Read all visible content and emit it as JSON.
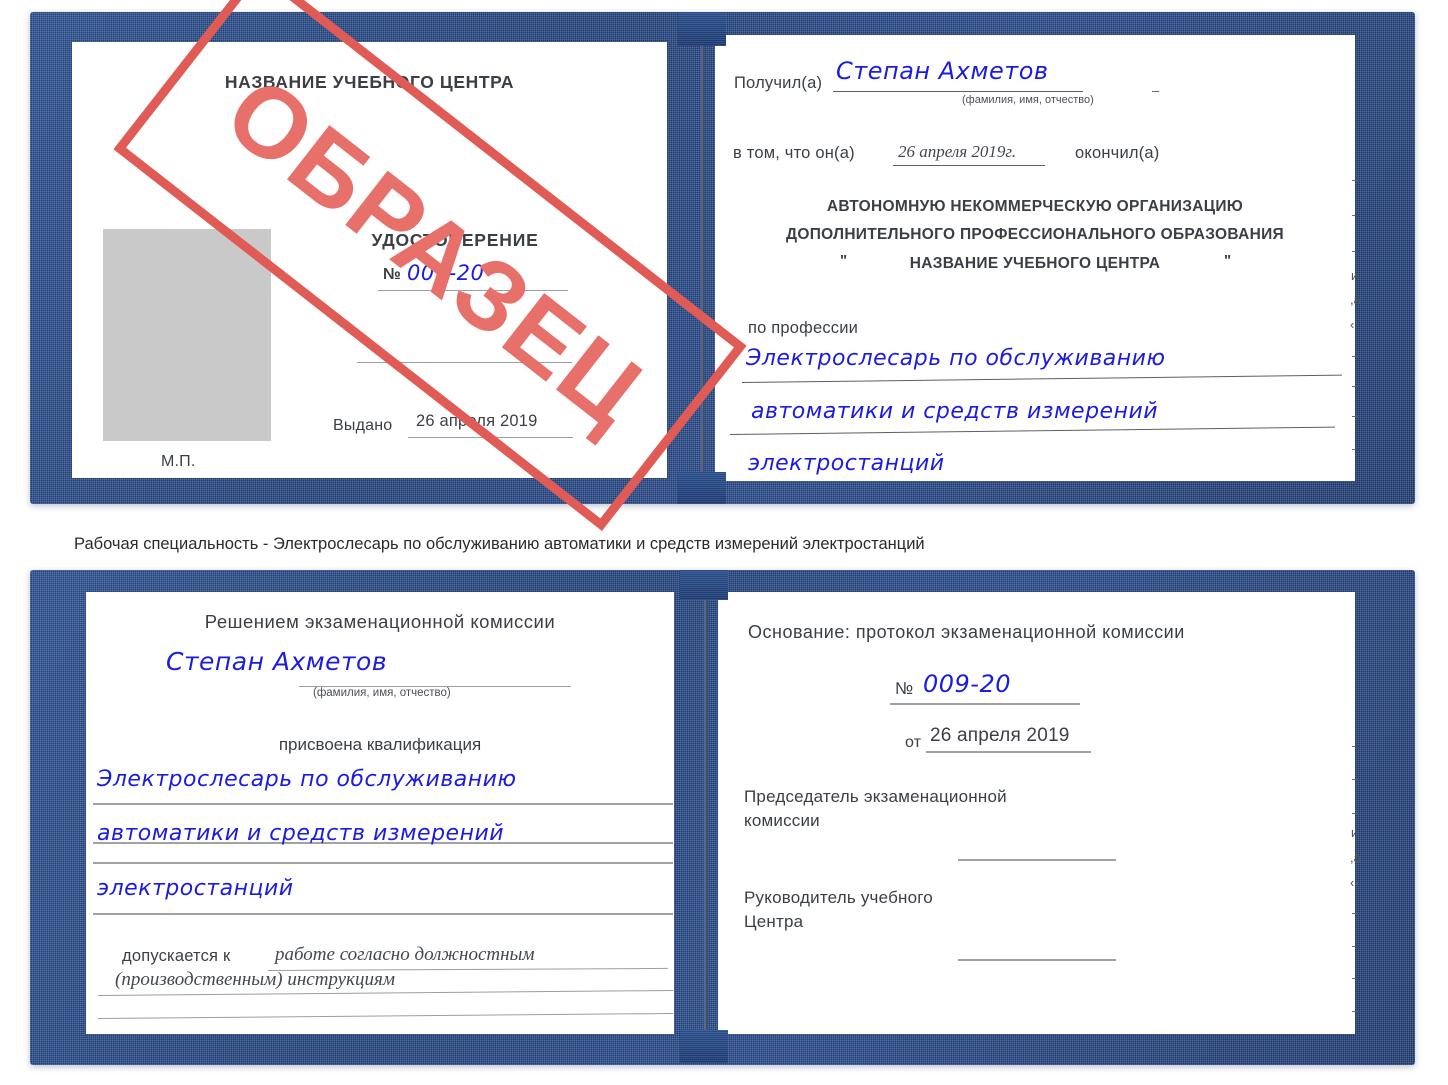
{
  "caption": {
    "text": "Рабочая специальность - Электрослесарь по обслуживанию автоматики и средств измерений электростанций"
  },
  "stamp": {
    "label": "ОБРАЗЕЦ",
    "color": "#e05b55"
  },
  "certificate_top": {
    "left_page": {
      "org_title": "НАЗВАНИЕ УЧЕБНОГО ЦЕНТРА",
      "doc_type": "УДОСТОВЕРЕНИЕ",
      "number_label": "№",
      "number_value": "009-20",
      "issued_label": "Выдано",
      "issued_value": "26 апреля 2019",
      "seal_label": "М.П.",
      "photo_placeholder": "photo-area"
    },
    "right_page": {
      "received_label": "Получил(а)",
      "received_value": "Степан Ахметов",
      "fio_hint": "(фамилия, имя, отчество)",
      "in_that_label": "в том, что он(а)",
      "completion_date": "26 апреля 2019г.",
      "finished_label": "окончил(а)",
      "org_line1": "АВТОНОМНУЮ НЕКОММЕРЧЕСКУЮ ОРГАНИЗАЦИЮ",
      "org_line2": "ДОПОЛНИТЕЛЬНОГО ПРОФЕССИОНАЛЬНОГО ОБРАЗОВАНИЯ",
      "org_quote_open": "\"",
      "org_line3": "НАЗВАНИЕ УЧЕБНОГО ЦЕНТРА",
      "org_quote_close": "\"",
      "profession_label": "по профессии",
      "profession_line1": "Электрослесарь по обслуживанию",
      "profession_line2": "автоматики и средств измерений",
      "profession_line3": "электростанций",
      "margin_fragments": [
        "–",
        "–",
        "–",
        "и",
        ",а",
        "‹-",
        "–",
        "–",
        "–",
        "–"
      ]
    }
  },
  "certificate_bottom": {
    "left_page": {
      "decision_title": "Решением экзаменационной комиссии",
      "name_value": "Степан Ахметов",
      "fio_hint": "(фамилия, имя, отчество)",
      "qualification_label": "присвоена квалификация",
      "qualification_line1": "Электрослесарь по обслуживанию",
      "qualification_line2": "автоматики и средств измерений",
      "qualification_line3": "электростанций",
      "allowed_label": "допускается к",
      "allowed_value_line1": "работе согласно должностным",
      "allowed_value_line2": "(производственным) инструкциям"
    },
    "right_page": {
      "basis_label": "Основание: протокол экзаменационной комиссии",
      "number_label": "№",
      "number_value": "009-20",
      "date_label": "от",
      "date_value": "26 апреля 2019",
      "chairman_line1": "Председатель экзаменационной",
      "chairman_line2": "комиссии",
      "head_line1": "Руководитель учебного",
      "head_line2": "Центра",
      "margin_fragments": [
        "–",
        "–",
        "–",
        "и",
        ",а",
        "‹-",
        "–",
        "–",
        "–",
        "–"
      ]
    }
  }
}
